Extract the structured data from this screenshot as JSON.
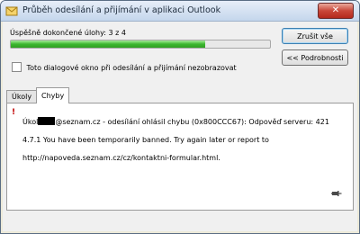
{
  "window": {
    "title": "Průběh odesílání a přijímání v aplikaci Outlook",
    "icon": "send-receive-icon"
  },
  "status": {
    "label": "Úspěšně dokončené úlohy: 3 z 4",
    "progress_fraction": 0.75
  },
  "buttons": {
    "cancel_all": "Zrušit vše",
    "details": "<< Podrobnosti"
  },
  "checkbox": {
    "label": "Toto dialogové okno při odesílání a přijímání nezobrazovat",
    "checked": false
  },
  "tabs": [
    {
      "label": "Úkoly",
      "active": false
    },
    {
      "label": "Chyby",
      "active": true
    }
  ],
  "errors": [
    {
      "icon": "error-exclamation-icon",
      "prefix": "Úkol",
      "line1_rest": "@seznam.cz - odesílání ohlásil chybu (0x800CCC67):   Odpověď serveru: 421",
      "line2": "4.7.1 You have been temporarily banned. Try again later or report to",
      "line3": "http://napoveda.seznam.cz/cz/kontaktni-formular.html."
    }
  ],
  "colors": {
    "progress_green": "#3cb72f",
    "error_red": "#c00000"
  }
}
